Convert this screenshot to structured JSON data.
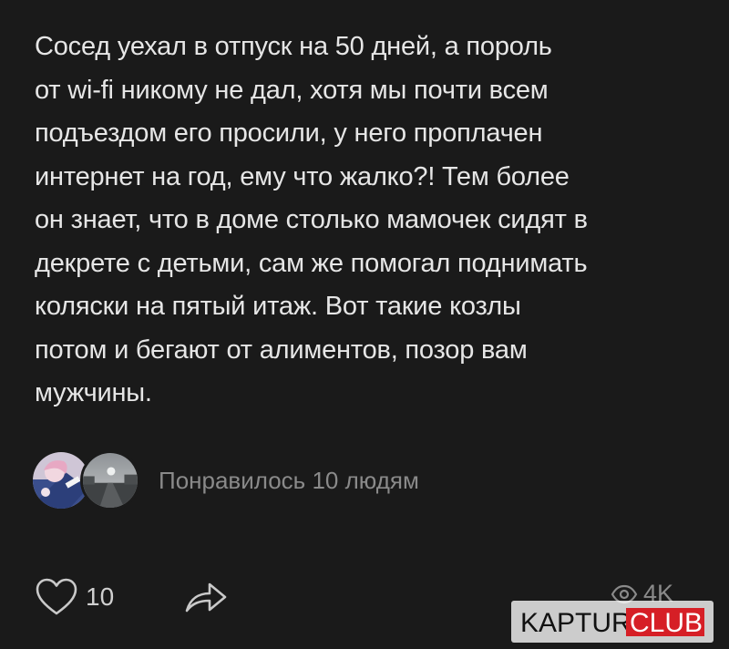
{
  "post": {
    "lines": [
      "Сосед уехал в отпуск на 50 дней, а пороль",
      "от wi-fi никому не дал, хотя мы почти всем",
      "подъездом его просили, у него проплачен",
      "интернет на год, ему что жалко?! Тем более",
      "он знает, что в доме столько мамочек сидят в",
      "декрете с детьми, сам же помогал поднимать",
      "коляски на пятый итаж. Вот такие козлы",
      "потом и бегают от алиментов, позор вам",
      "мужчины."
    ]
  },
  "likes": {
    "summary": "Понравилось 10 людям",
    "avatars": [
      "avatar-anime",
      "avatar-road-photo"
    ]
  },
  "actions": {
    "like_icon": "heart-icon",
    "like_count": "10",
    "share_icon": "share-arrow-icon"
  },
  "views": {
    "icon": "eye-icon",
    "count": "4K"
  },
  "watermark": {
    "text_primary": "KAPTUR.",
    "text_accent": "CLUB",
    "accent_color": "#d61f26"
  },
  "colors": {
    "background": "#1a1a1a",
    "text": "#e6e6e6",
    "muted": "#8a8a8a"
  }
}
